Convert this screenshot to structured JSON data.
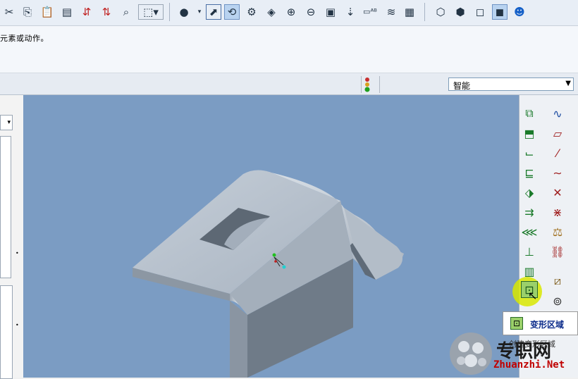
{
  "message": {
    "text": "元素或动作。"
  },
  "filter": {
    "value": "智能"
  },
  "tooltip": {
    "title": "变形区域",
    "description": "创建变形区域"
  },
  "watermark": {
    "chinese": "专职网",
    "url": "Zhuanzhi.Net"
  },
  "colors": {
    "viewport": "#7b9cc3",
    "highlight": "#d8e800",
    "accent": "#6f93c4"
  },
  "toolbar_icons": [
    "cut-icon",
    "copy-icon",
    "paste-icon",
    "paste-special-icon",
    "regenerate-icon",
    "regenerate-manager-icon",
    "find-icon",
    "select-box-icon",
    "shading-icon",
    "repaint-icon",
    "spin-center-icon",
    "datum-display-icon",
    "orient-icon",
    "zoom-in-icon",
    "zoom-out-icon",
    "refit-icon",
    "view-manager-icon",
    "annotation-icon",
    "layers-icon",
    "saved-views-icon",
    "wireframe-icon",
    "hidden-line-icon",
    "no-hidden-icon",
    "shaded-icon",
    "model-tree-icon"
  ],
  "right_toolbar_icons": [
    "datum-plane-icon",
    "sketch-icon",
    "extrude-icon",
    "datum-axis-icon",
    "revolve-icon",
    "datum-curve-icon",
    "sweep-icon",
    "datum-point-icon",
    "blend-icon",
    "coordinate-system-icon",
    "rib-icon",
    "analysis-icon",
    "draft-icon",
    "hole-icon",
    "shell-icon",
    "round-icon",
    "warp-region-icon",
    "mirror-icon"
  ]
}
